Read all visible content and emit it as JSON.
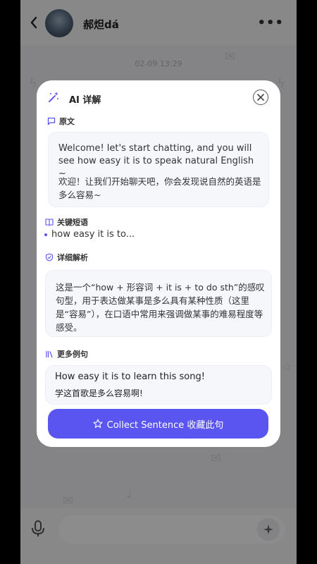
{
  "header": {
    "contact_name": "郝炟dá",
    "more_label": "•••",
    "back_icon": "chevron-left-icon"
  },
  "chat": {
    "timestamp": "02-09 13:29"
  },
  "modal": {
    "title": "AI 详解",
    "sections": {
      "original": {
        "label": "原文",
        "english": "Welcome! let's start chatting, and you will see how easy it is to speak natural English ~",
        "chinese": "欢迎！让我们开始聊天吧，你会发现说自然的英语是多么容易~"
      },
      "phrases": {
        "label": "关键短语",
        "items": [
          "how easy it is to..."
        ]
      },
      "analysis": {
        "label": "详细解析",
        "text": "这是一个“how + 形容词 + it is + to do sth”的感叹句型，用于表达做某事是多么具有某种性质（这里是“容易”），在口语中常用来强调做某事的难易程度等感受。"
      },
      "examples": {
        "label": "更多例句",
        "items": [
          {
            "en": "How easy it is to learn this song!",
            "zh": "学这首歌是多么容易啊!"
          }
        ]
      }
    },
    "collect_button": "Collect Sentence 收藏此句"
  },
  "colors": {
    "accent": "#5a55f0",
    "card_bg": "#f6f7fb"
  }
}
